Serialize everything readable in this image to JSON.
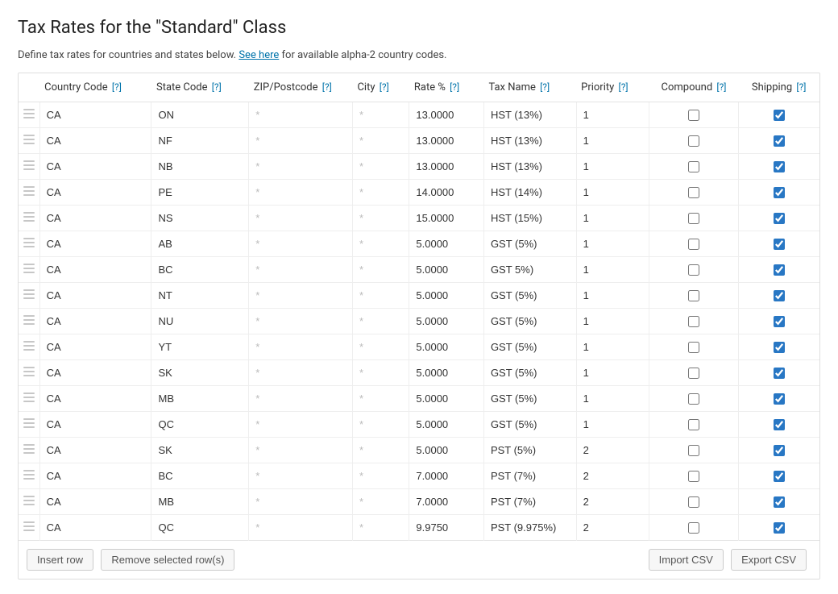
{
  "title": "Tax Rates for the \"Standard\" Class",
  "intro_pre": "Define tax rates for countries and states below. ",
  "intro_link": "See here",
  "intro_post": " for available alpha-2 country codes.",
  "help_mark": "[?]",
  "star": "*",
  "columns": {
    "country": "Country Code",
    "state": "State Code",
    "zip": "ZIP/Postcode",
    "city": "City",
    "rate": "Rate %",
    "name": "Tax Name",
    "priority": "Priority",
    "compound": "Compound",
    "shipping": "Shipping"
  },
  "footer": {
    "insert": "Insert row",
    "remove": "Remove selected row(s)",
    "import": "Import CSV",
    "export": "Export CSV"
  },
  "rows": [
    {
      "country": "CA",
      "state": "ON",
      "zip": "",
      "city": "",
      "rate": "13.0000",
      "name": "HST (13%)",
      "priority": "1",
      "compound": false,
      "shipping": true
    },
    {
      "country": "CA",
      "state": "NF",
      "zip": "",
      "city": "",
      "rate": "13.0000",
      "name": "HST (13%)",
      "priority": "1",
      "compound": false,
      "shipping": true
    },
    {
      "country": "CA",
      "state": "NB",
      "zip": "",
      "city": "",
      "rate": "13.0000",
      "name": "HST (13%)",
      "priority": "1",
      "compound": false,
      "shipping": true
    },
    {
      "country": "CA",
      "state": "PE",
      "zip": "",
      "city": "",
      "rate": "14.0000",
      "name": "HST (14%)",
      "priority": "1",
      "compound": false,
      "shipping": true
    },
    {
      "country": "CA",
      "state": "NS",
      "zip": "",
      "city": "",
      "rate": "15.0000",
      "name": "HST (15%)",
      "priority": "1",
      "compound": false,
      "shipping": true
    },
    {
      "country": "CA",
      "state": "AB",
      "zip": "",
      "city": "",
      "rate": "5.0000",
      "name": "GST (5%)",
      "priority": "1",
      "compound": false,
      "shipping": true
    },
    {
      "country": "CA",
      "state": "BC",
      "zip": "",
      "city": "",
      "rate": "5.0000",
      "name": "GST 5%)",
      "priority": "1",
      "compound": false,
      "shipping": true
    },
    {
      "country": "CA",
      "state": "NT",
      "zip": "",
      "city": "",
      "rate": "5.0000",
      "name": "GST (5%)",
      "priority": "1",
      "compound": false,
      "shipping": true
    },
    {
      "country": "CA",
      "state": "NU",
      "zip": "",
      "city": "",
      "rate": "5.0000",
      "name": "GST (5%)",
      "priority": "1",
      "compound": false,
      "shipping": true
    },
    {
      "country": "CA",
      "state": "YT",
      "zip": "",
      "city": "",
      "rate": "5.0000",
      "name": "GST (5%)",
      "priority": "1",
      "compound": false,
      "shipping": true
    },
    {
      "country": "CA",
      "state": "SK",
      "zip": "",
      "city": "",
      "rate": "5.0000",
      "name": "GST (5%)",
      "priority": "1",
      "compound": false,
      "shipping": true
    },
    {
      "country": "CA",
      "state": "MB",
      "zip": "",
      "city": "",
      "rate": "5.0000",
      "name": "GST (5%)",
      "priority": "1",
      "compound": false,
      "shipping": true
    },
    {
      "country": "CA",
      "state": "QC",
      "zip": "",
      "city": "",
      "rate": "5.0000",
      "name": "GST (5%)",
      "priority": "1",
      "compound": false,
      "shipping": true
    },
    {
      "country": "CA",
      "state": "SK",
      "zip": "",
      "city": "",
      "rate": "5.0000",
      "name": "PST (5%)",
      "priority": "2",
      "compound": false,
      "shipping": true
    },
    {
      "country": "CA",
      "state": "BC",
      "zip": "",
      "city": "",
      "rate": "7.0000",
      "name": "PST (7%)",
      "priority": "2",
      "compound": false,
      "shipping": true
    },
    {
      "country": "CA",
      "state": "MB",
      "zip": "",
      "city": "",
      "rate": "7.0000",
      "name": "PST (7%)",
      "priority": "2",
      "compound": false,
      "shipping": true
    },
    {
      "country": "CA",
      "state": "QC",
      "zip": "",
      "city": "",
      "rate": "9.9750",
      "name": "PST (9.975%)",
      "priority": "2",
      "compound": false,
      "shipping": true
    }
  ]
}
